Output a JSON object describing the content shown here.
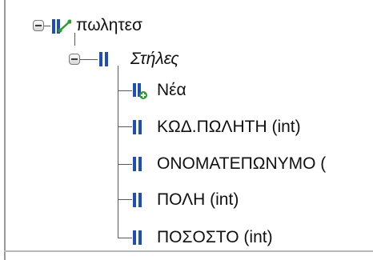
{
  "tree": {
    "table": {
      "label": "πωλητεσ",
      "icon": "table-relation-icon",
      "expanded": true,
      "folder": {
        "label": "Στήλες",
        "icon": "columns-folder-icon",
        "expanded": true,
        "items": [
          {
            "label": "Νέα",
            "icon": "new-column-icon"
          },
          {
            "label": "ΚΩΔ.ΠΩΛΗΤΗ (int)",
            "icon": "column-icon"
          },
          {
            "label": "ΟΝΟΜΑΤΕΠΩΝΥΜΟ (",
            "icon": "column-icon"
          },
          {
            "label": "ΠΟΛΗ (int)",
            "icon": "column-icon"
          },
          {
            "label": "ΠΟΣΟΣΤΟ (int)",
            "icon": "column-icon"
          }
        ]
      }
    }
  },
  "colors": {
    "column_icon": "#1f4fb3",
    "new_badge": "#2e9b2e",
    "connector": "#5a5a5a"
  }
}
